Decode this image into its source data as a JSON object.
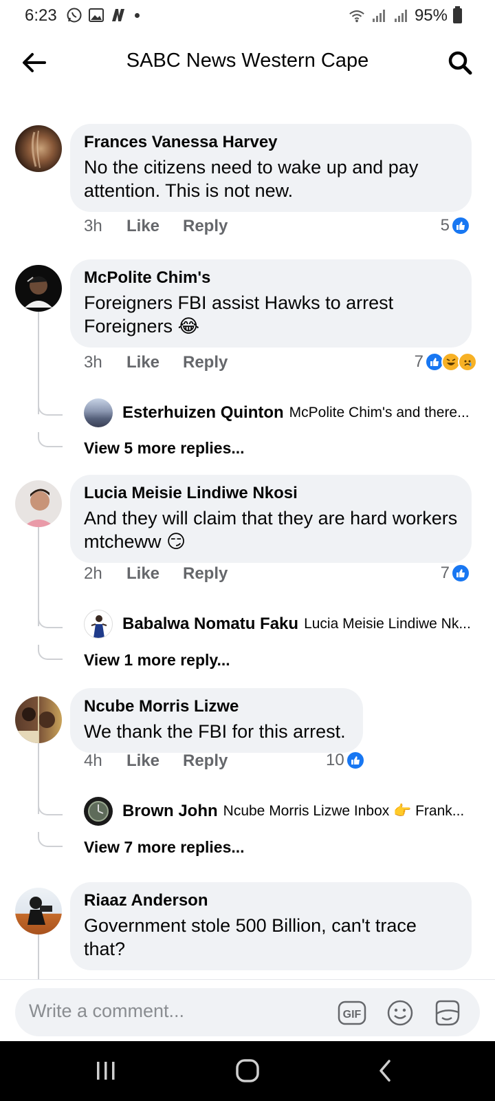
{
  "status_bar": {
    "time": "6:23",
    "battery": "95%",
    "icons": [
      "whatsapp-icon",
      "gallery-icon",
      "n-app-icon",
      "notification-dot",
      "wifi-icon",
      "signal-icon",
      "signal-icon",
      "battery-icon"
    ]
  },
  "header": {
    "title": "SABC News Western Cape",
    "back_icon": "arrow-left-icon",
    "search_icon": "search-icon"
  },
  "colors": {
    "bubble": "#f0f2f5",
    "like_blue": "#1877f2",
    "meta_gray": "#65676b",
    "thread_line": "#ced0d4"
  },
  "comments": [
    {
      "author": "Frances Vanessa Harvey",
      "text": "No the citizens need to wake up and pay attention. This is not new.",
      "time": "3h",
      "like_label": "Like",
      "reply_label": "Reply",
      "reaction_count": "5",
      "reactions": [
        "like"
      ]
    },
    {
      "author": "McPolite Chim's",
      "text": "Foreigners FBI assist Hawks to arrest Foreigners 😂",
      "time": "3h",
      "like_label": "Like",
      "reply_label": "Reply",
      "reaction_count": "7",
      "reactions": [
        "like",
        "haha",
        "sad"
      ],
      "reply_preview": {
        "author": "Esterhuizen Quinton",
        "text": "McPolite Chim's and there..."
      },
      "view_more": "View 5 more replies..."
    },
    {
      "author": "Lucia Meisie Lindiwe Nkosi",
      "text": "And they will claim that they are hard workers mtcheww 😏",
      "time": "2h",
      "like_label": "Like",
      "reply_label": "Reply",
      "reaction_count": "7",
      "reactions": [
        "like"
      ],
      "reply_preview": {
        "author": "Babalwa Nomatu Faku",
        "text": "Lucia Meisie Lindiwe Nk..."
      },
      "view_more": "View 1 more reply..."
    },
    {
      "author": "Ncube Morris Lizwe",
      "text": "We thank the FBI for this arrest.",
      "time": "4h",
      "like_label": "Like",
      "reply_label": "Reply",
      "reaction_count": "10",
      "reactions": [
        "like"
      ],
      "reply_preview": {
        "author": "Brown John",
        "text": "Ncube Morris Lizwe Inbox 👉 Frank..."
      },
      "view_more": "View 7 more replies..."
    },
    {
      "author": "Riaaz Anderson",
      "text": "Government stole 500 Billion, can't trace that?"
    }
  ],
  "composer": {
    "placeholder": "Write a comment...",
    "gif_label": "GIF",
    "emoji_icon": "smiley-icon",
    "sticker_icon": "sticker-icon"
  },
  "nav": {
    "recents_icon": "recents-icon",
    "home_icon": "home-icon",
    "back_icon": "back-chevron-icon"
  }
}
